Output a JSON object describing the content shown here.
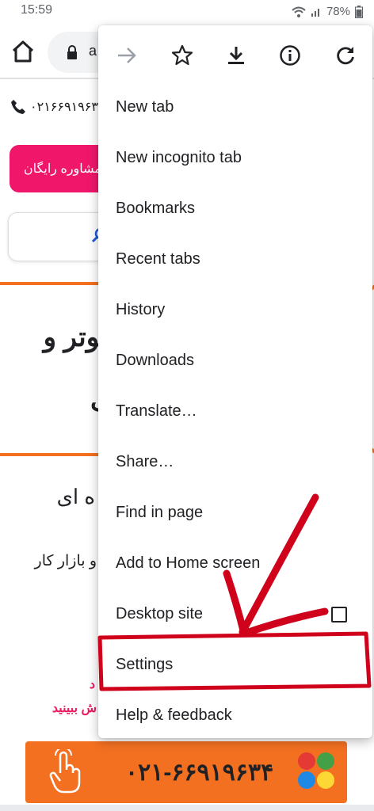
{
  "status": {
    "time": "15:59",
    "battery": "78%"
  },
  "toolbar": {
    "omnibox_text": "a"
  },
  "page": {
    "phone": "۰۲۱۶۶۹۱۹۶۳",
    "consult_label": "مشاوره رایگان",
    "hero_line1": "پیوتر و",
    "hero_line2": "ت",
    "text_line1": "ه ای",
    "text_line2": "و بازار کار",
    "red_line1": "د",
    "red_line2": "ش ببینید",
    "call_number": "۰۲۱-۶۶۹۱۹۶۳۴"
  },
  "menu": {
    "icons": [
      "forward-icon",
      "star-icon",
      "download-icon",
      "info-icon",
      "refresh-icon"
    ],
    "items": [
      "New tab",
      "New incognito tab",
      "Bookmarks",
      "Recent tabs",
      "History",
      "Downloads",
      "Translate…",
      "Share…",
      "Find in page",
      "Add to Home screen",
      "Desktop site",
      "Settings",
      "Help & feedback"
    ]
  },
  "colors": {
    "accent_pink": "#f0166a",
    "orange": "#f37021",
    "annotation_red": "#d0021b"
  }
}
